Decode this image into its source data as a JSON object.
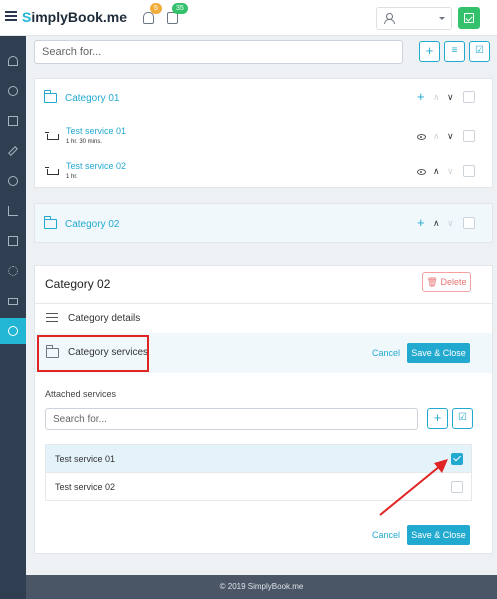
{
  "header": {
    "logo_text": "SimplyBook.me",
    "notifications_count": "5",
    "tasks_count": "35",
    "icons": [
      "hamburger-icon",
      "bell-icon",
      "calendar-icon",
      "user-icon",
      "chevron-down-icon",
      "check-square-icon"
    ]
  },
  "sidebar": {
    "items": [
      {
        "icon": "dashboard-icon",
        "active": false
      },
      {
        "icon": "lightbulb-icon",
        "active": false
      },
      {
        "icon": "calendar-icon",
        "active": false
      },
      {
        "icon": "pencil-icon",
        "active": false
      },
      {
        "icon": "clock-icon",
        "active": false
      },
      {
        "icon": "chart-icon",
        "active": false
      },
      {
        "icon": "gift-icon",
        "active": false
      },
      {
        "icon": "gear-icon",
        "active": false
      },
      {
        "icon": "money-icon",
        "active": false
      },
      {
        "icon": "chat-icon",
        "active": true
      }
    ]
  },
  "search": {
    "placeholder": "Search for..."
  },
  "categories": [
    {
      "label": "Category 01",
      "services": [
        {
          "title": "Test service 01",
          "duration": "1 hr. 30 mins."
        },
        {
          "title": "Test service 02",
          "duration": "1 hr."
        }
      ]
    },
    {
      "label": "Category 02",
      "services": []
    }
  ],
  "panel": {
    "title": "Category 02",
    "delete_label": "Delete",
    "details_label": "Category details",
    "services_label": "Category services",
    "cancel_label": "Cancel",
    "save_close_label": "Save & Close",
    "attached_label": "Attached services",
    "attached_search_placeholder": "Search for...",
    "attached_services": [
      {
        "name": "Test service 01",
        "checked": true
      },
      {
        "name": "Test service 02",
        "checked": false
      }
    ]
  },
  "footer": {
    "text": "© 2019 SimplyBook.me"
  },
  "colors": {
    "accent": "#22a9d0",
    "sidebar": "#2f3e51",
    "green": "#34c16b",
    "badge_orange": "#f0ad3c",
    "annotation_red": "#e02424"
  }
}
